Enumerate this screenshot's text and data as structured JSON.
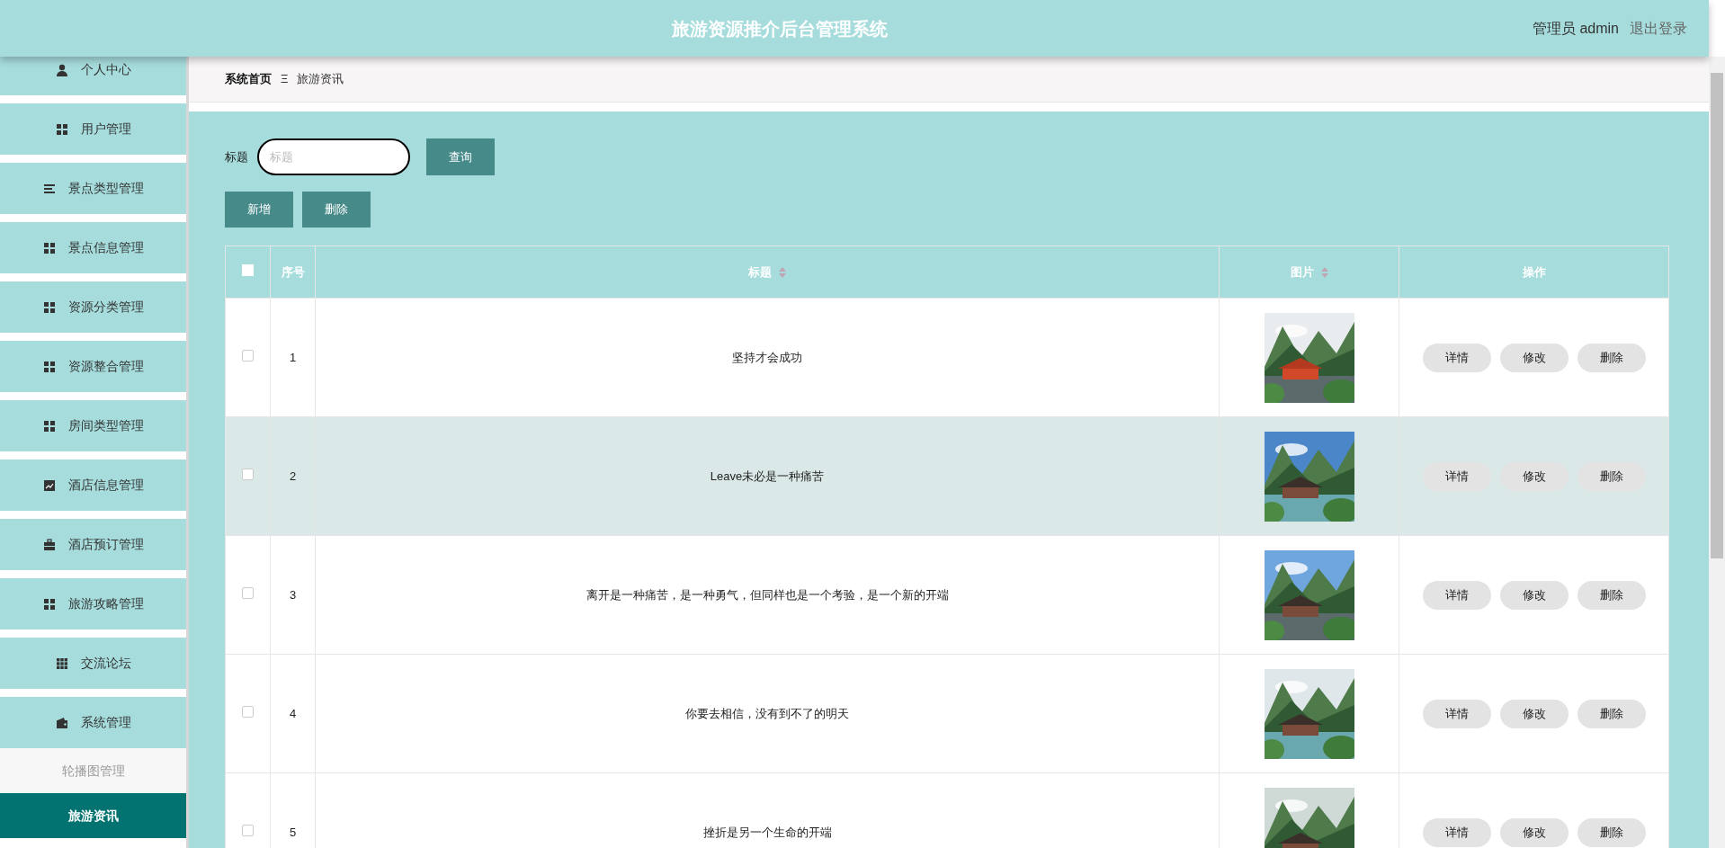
{
  "header": {
    "title": "旅游资源推介后台管理系统",
    "user": "管理员 admin",
    "logout": "退出登录"
  },
  "sidebar": {
    "items": [
      {
        "label": "个人中心",
        "kind": "person",
        "selected": false
      },
      {
        "label": "用户管理",
        "kind": "grid",
        "selected": false
      },
      {
        "label": "景点类型管理",
        "kind": "list",
        "selected": false
      },
      {
        "label": "景点信息管理",
        "kind": "grid",
        "selected": false
      },
      {
        "label": "资源分类管理",
        "kind": "grid",
        "selected": false
      },
      {
        "label": "资源整合管理",
        "kind": "grid",
        "selected": false
      },
      {
        "label": "房间类型管理",
        "kind": "grid",
        "selected": false
      },
      {
        "label": "酒店信息管理",
        "kind": "chart",
        "selected": false
      },
      {
        "label": "酒店预订管理",
        "kind": "briefcase",
        "selected": false
      },
      {
        "label": "旅游攻略管理",
        "kind": "grid",
        "selected": false
      },
      {
        "label": "交流论坛",
        "kind": "grid9",
        "selected": false
      },
      {
        "label": "系统管理",
        "kind": "wallet",
        "selected": false,
        "children": [
          {
            "label": "轮播图管理",
            "selected": false
          },
          {
            "label": "旅游资讯",
            "selected": true
          }
        ]
      }
    ]
  },
  "breadcrumb": {
    "home": "系统首页",
    "separator": "Ξ",
    "current": "旅游资讯"
  },
  "search": {
    "label": "标题",
    "placeholder": "标题",
    "button": "查询"
  },
  "actions": [
    "新增",
    "删除"
  ],
  "table": {
    "all_checked": false,
    "columns": [
      {
        "label": "序号",
        "sortable": false
      },
      {
        "label": "标题",
        "sortable": true
      },
      {
        "label": "图片",
        "sortable": true
      },
      {
        "label": "操作",
        "sortable": false
      }
    ],
    "rows": [
      {
        "index": "1",
        "title": "坚持才会成功",
        "checked": false,
        "hovered": false,
        "picture": {
          "kind": "picture"
        },
        "buttons": [
          "详情",
          "修改",
          "删除"
        ]
      },
      {
        "index": "2",
        "title": "Leave未必是一种痛苦",
        "checked": false,
        "hovered": true,
        "picture": {
          "kind": "picture"
        },
        "buttons": [
          "详情",
          "修改",
          "删除"
        ]
      },
      {
        "index": "3",
        "title": "离开是一种痛苦，是一种勇气，但同样也是一个考验，是一个新的开端",
        "checked": false,
        "hovered": false,
        "picture": {
          "kind": "picture"
        },
        "buttons": [
          "详情",
          "修改",
          "删除"
        ]
      },
      {
        "index": "4",
        "title": "你要去相信，没有到不了的明天",
        "checked": false,
        "hovered": false,
        "picture": {
          "kind": "picture"
        },
        "buttons": [
          "详情",
          "修改",
          "删除"
        ]
      },
      {
        "index": "5",
        "title": "挫折是另一个生命的开端",
        "checked": false,
        "hovered": false,
        "picture": {
          "kind": "picture"
        },
        "buttons": [
          "详情",
          "修改",
          "删除"
        ]
      }
    ]
  }
}
